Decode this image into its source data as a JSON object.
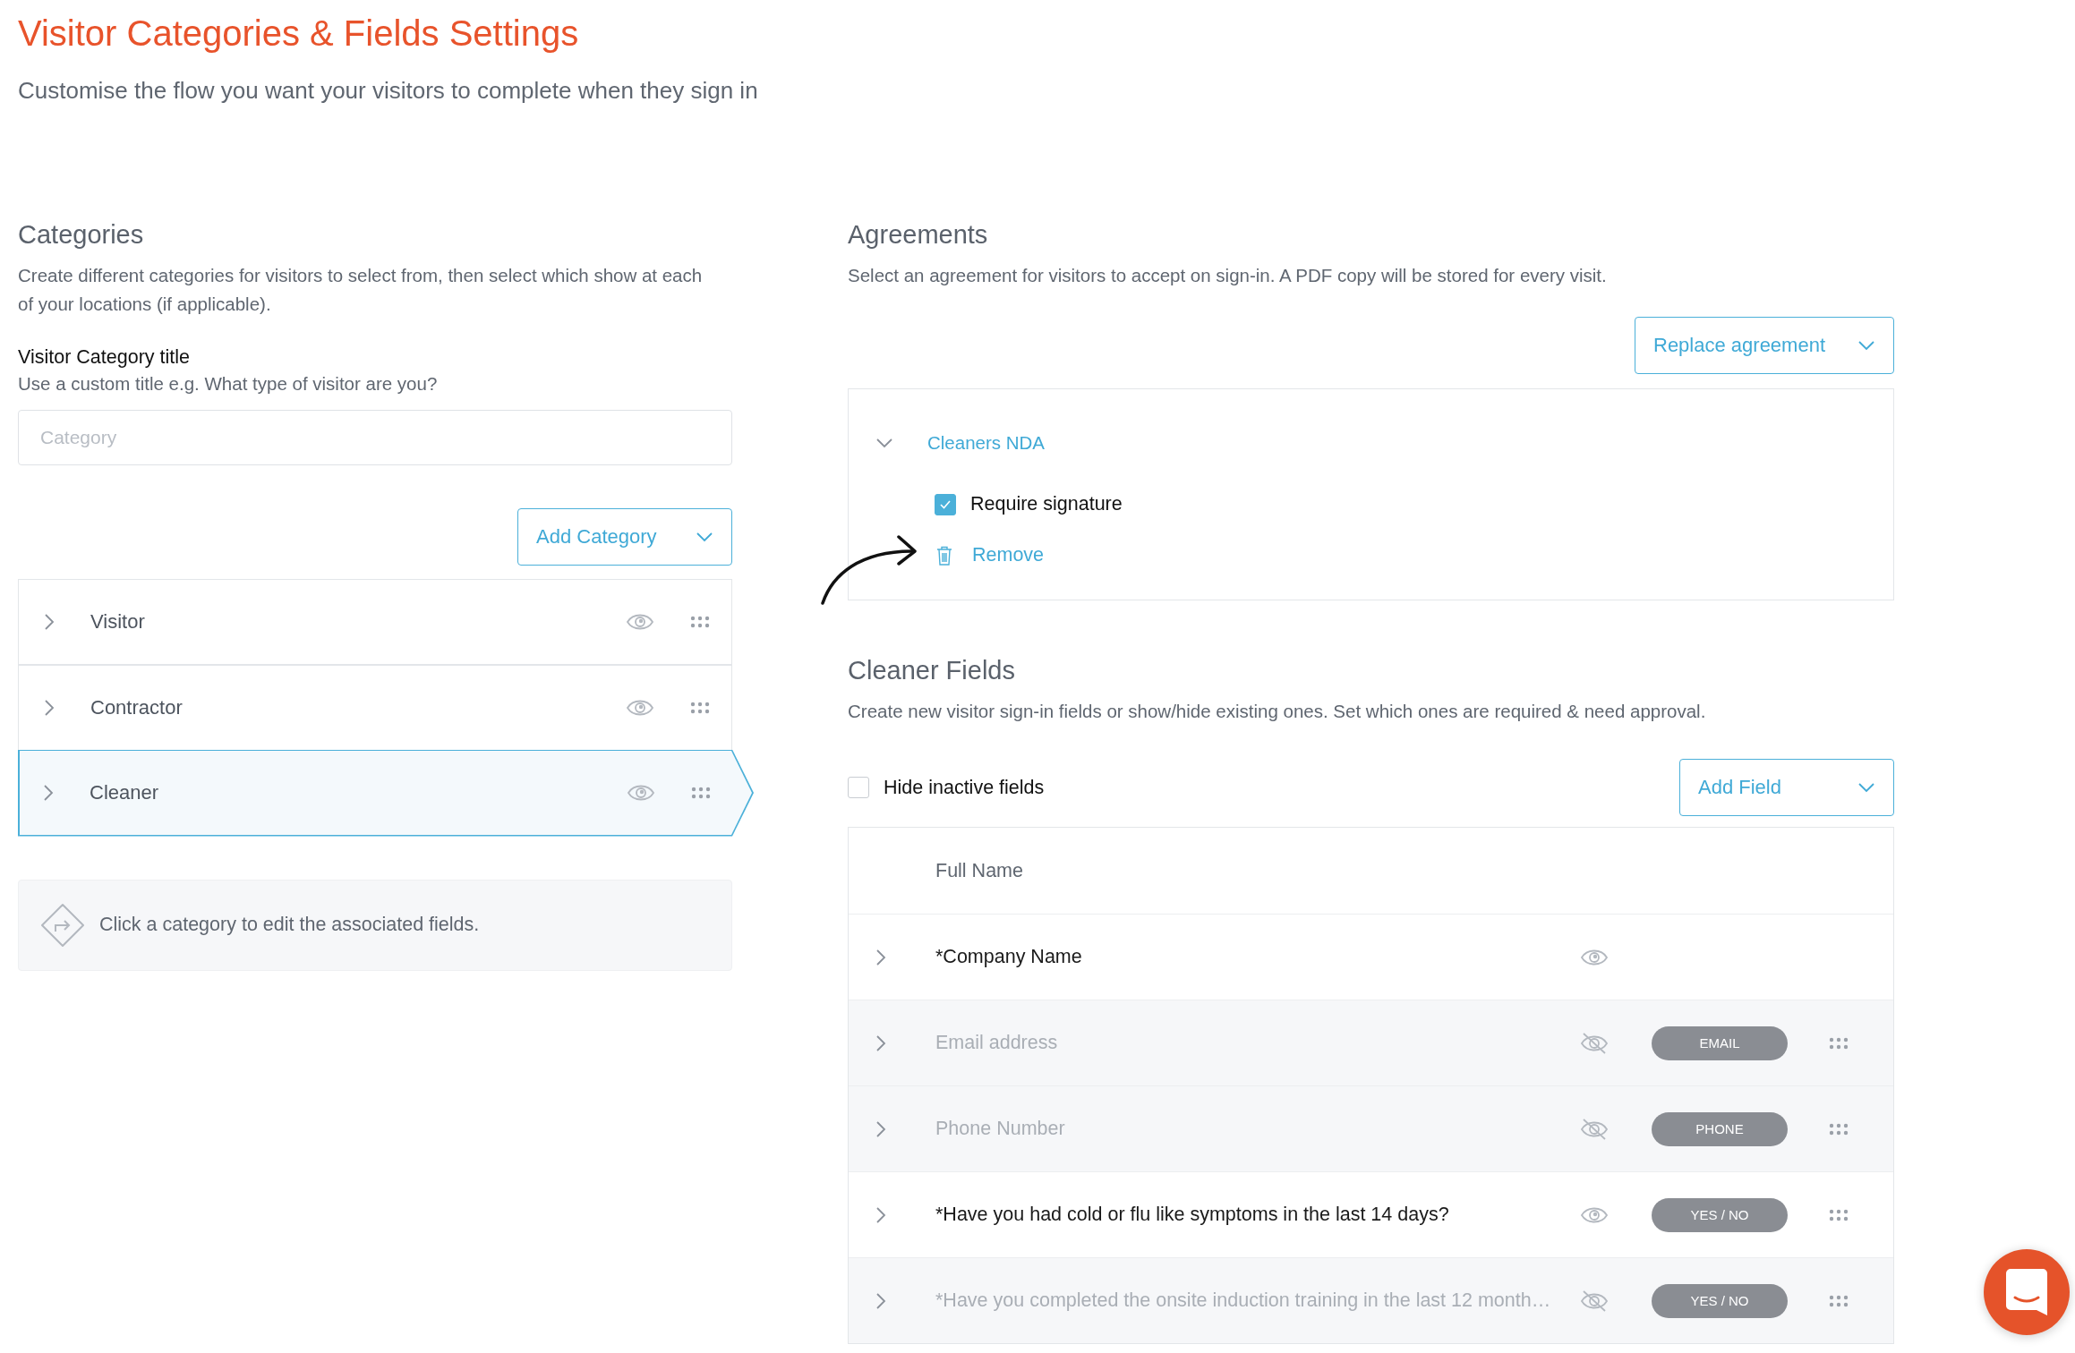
{
  "header": {
    "title": "Visitor Categories & Fields Settings",
    "subtitle": "Customise the flow you want your visitors to complete when they sign in"
  },
  "categories": {
    "heading": "Categories",
    "description": "Create different categories for visitors to select from, then select which show at each of your locations (if applicable).",
    "title_label": "Visitor Category title",
    "title_hint": "Use a custom title e.g. What type of visitor are you?",
    "title_field": {
      "placeholder": "Category"
    },
    "add_button": "Add Category",
    "items": [
      {
        "label": "Visitor",
        "selected": false,
        "visible": true
      },
      {
        "label": "Contractor",
        "selected": false,
        "visible": true
      },
      {
        "label": "Cleaner",
        "selected": true,
        "visible": true
      }
    ],
    "hint": "Click a category to edit the associated fields."
  },
  "agreements": {
    "heading": "Agreements",
    "description": "Select an agreement for visitors to accept on sign-in. A PDF copy will be stored for every visit.",
    "replace_button": "Replace agreement",
    "agreement": {
      "name": "Cleaners NDA",
      "expanded": true,
      "require_signature": {
        "label": "Require signature",
        "checked": true
      },
      "remove_link": "Remove"
    }
  },
  "fields": {
    "heading": "Cleaner Fields",
    "description": "Create new visitor sign-in fields or show/hide existing ones. Set which ones are required & need approval.",
    "hide_inactive": {
      "label": "Hide inactive fields",
      "checked": false
    },
    "add_button": "Add Field",
    "rows": [
      {
        "kind": "fixed",
        "label": "Full Name"
      },
      {
        "kind": "field",
        "label": "*Company Name",
        "active": true
      },
      {
        "kind": "field",
        "label": "Email address",
        "active": false,
        "tag": "EMAIL"
      },
      {
        "kind": "field",
        "label": "Phone Number",
        "active": false,
        "tag": "PHONE"
      },
      {
        "kind": "field",
        "label": "*Have you had cold or flu like symptoms in the last 14 days?",
        "active": true,
        "tag": "YES / NO"
      },
      {
        "kind": "field",
        "label": "*Have you completed the onsite induction training in the last 12 month…",
        "active": false,
        "tag": "YES / NO"
      }
    ]
  }
}
